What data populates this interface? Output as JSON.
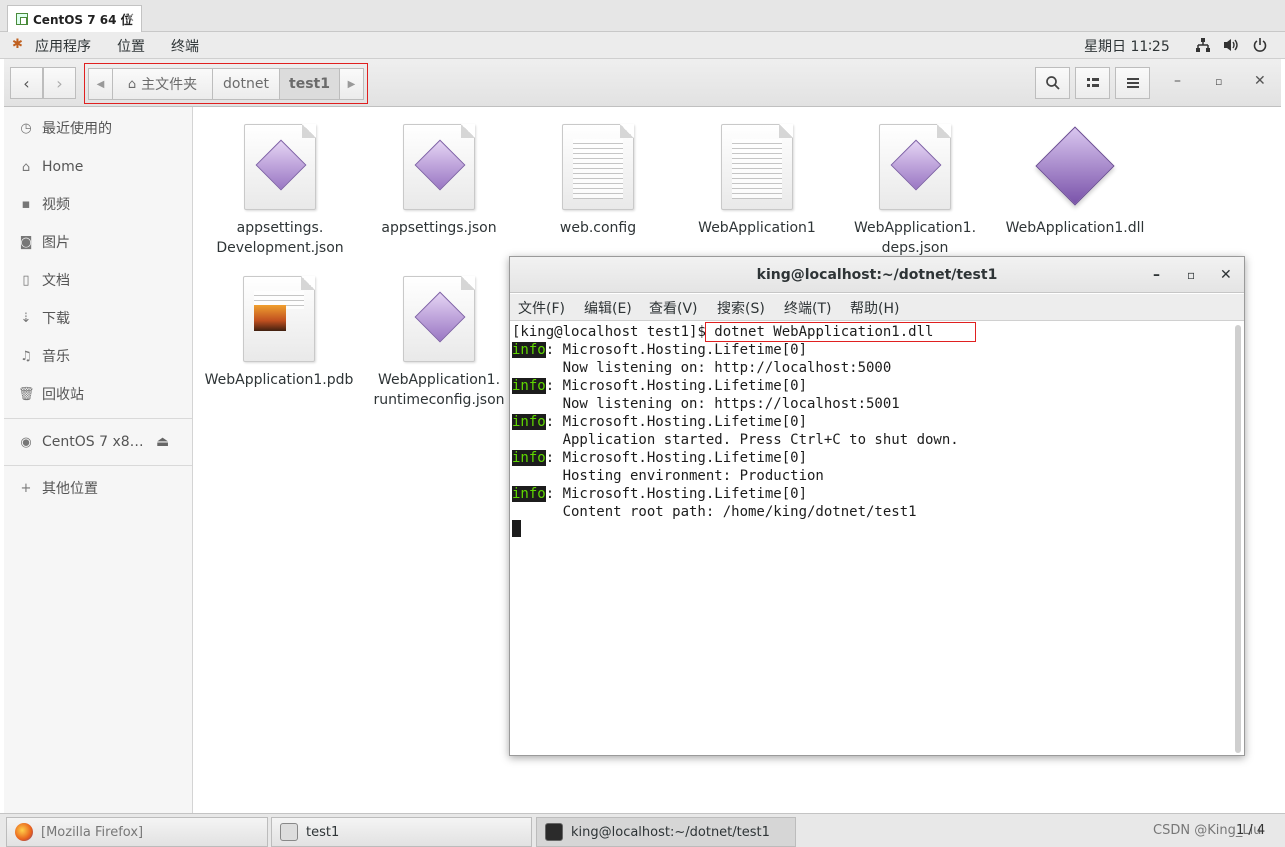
{
  "vm": {
    "tab_title": "CentOS 7 64 位",
    "close": "✕"
  },
  "topbar": {
    "menus": [
      "应用程序",
      "位置",
      "终端"
    ],
    "clock": "星期日 11∶25"
  },
  "filemanager": {
    "breadcrumbs": [
      "主文件夹",
      "dotnet",
      "test1"
    ],
    "sidebar": [
      {
        "label": "最近使用的",
        "icon": "clock-icon"
      },
      {
        "label": "Home",
        "icon": "home-icon"
      },
      {
        "label": "视频",
        "icon": "video-icon"
      },
      {
        "label": "图片",
        "icon": "camera-icon"
      },
      {
        "label": "文档",
        "icon": "document-icon"
      },
      {
        "label": "下载",
        "icon": "download-icon"
      },
      {
        "label": "音乐",
        "icon": "music-icon"
      },
      {
        "label": "回收站",
        "icon": "trash-icon"
      },
      {
        "label": "CentOS 7 x8…",
        "icon": "disc-icon"
      },
      {
        "label": "其他位置",
        "icon": "plus-icon"
      }
    ],
    "files": [
      {
        "name": "appsettings.\nDevelopment.json",
        "icon": "json-file-icon"
      },
      {
        "name": "appsettings.json",
        "icon": "json-file-icon"
      },
      {
        "name": "web.config",
        "icon": "text-file-icon"
      },
      {
        "name": "WebApplication1",
        "icon": "text-file-icon"
      },
      {
        "name": "WebApplication1.\ndeps.json",
        "icon": "json-file-icon"
      },
      {
        "name": "WebApplication1.dll",
        "icon": "dll-file-icon"
      },
      {
        "name": "WebApplication1.pdb",
        "icon": "pdb-file-icon"
      },
      {
        "name": "WebApplication1.\nruntimeconfig.json",
        "icon": "json-file-icon"
      }
    ]
  },
  "terminal": {
    "title": "king@localhost:~/dotnet/test1",
    "menus": [
      "文件(F)",
      "编辑(E)",
      "查看(V)",
      "搜索(S)",
      "终端(T)",
      "帮助(H)"
    ],
    "prompt": "[king@localhost test1]",
    "command": "$ dotnet WebApplication1.dll",
    "info_tag": "info",
    "lines": [
      {
        "info": true,
        "text": ": Microsoft.Hosting.Lifetime[0]"
      },
      {
        "info": false,
        "text": "      Now listening on: http://localhost:5000"
      },
      {
        "info": true,
        "text": ": Microsoft.Hosting.Lifetime[0]"
      },
      {
        "info": false,
        "text": "      Now listening on: https://localhost:5001"
      },
      {
        "info": true,
        "text": ": Microsoft.Hosting.Lifetime[0]"
      },
      {
        "info": false,
        "text": "      Application started. Press Ctrl+C to shut down."
      },
      {
        "info": true,
        "text": ": Microsoft.Hosting.Lifetime[0]"
      },
      {
        "info": false,
        "text": "      Hosting environment: Production"
      },
      {
        "info": true,
        "text": ": Microsoft.Hosting.Lifetime[0]"
      },
      {
        "info": false,
        "text": "      Content root path: /home/king/dotnet/test1"
      }
    ]
  },
  "taskbar": {
    "items": [
      "[Mozilla Firefox]",
      "test1",
      "king@localhost:~/dotnet/test1"
    ],
    "watermark": "CSDN @King_Liu"
  },
  "pager": "1 / 4",
  "colors": {
    "highlight_box": "#e02020",
    "info_fg": "#5fd700",
    "info_bg": "#1c1c1c"
  }
}
